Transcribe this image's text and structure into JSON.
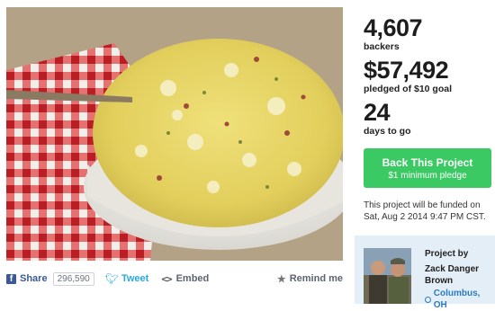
{
  "hero": {
    "image": "potato-salad-photo"
  },
  "share": {
    "facebook_icon": "facebook-icon",
    "facebook_label": "Share",
    "facebook_count": "296,590",
    "twitter_icon": "twitter-bird-icon",
    "twitter_label": "Tweet",
    "embed_icon": "code-brackets-icon",
    "embed_label": "Embed",
    "remind_icon": "star-icon",
    "remind_label": "Remind me"
  },
  "stats": {
    "backers_value": "4,607",
    "backers_label": "backers",
    "pledged_value": "$57,492",
    "pledged_label": "pledged of $10 goal",
    "days_value": "24",
    "days_label": "days to go"
  },
  "cta": {
    "title": "Back This Project",
    "subtitle": "$1 minimum pledge",
    "color": "#3bc964"
  },
  "funding_note": {
    "line1": "This project will be funded on",
    "line2": "Sat, Aug 2 2014 9:47 PM CST."
  },
  "creator": {
    "heading": "Project by",
    "name": "Zack Danger Brown",
    "location": "Columbus, OH",
    "location_icon": "map-pin-icon",
    "link_color": "#2a7bc4"
  }
}
